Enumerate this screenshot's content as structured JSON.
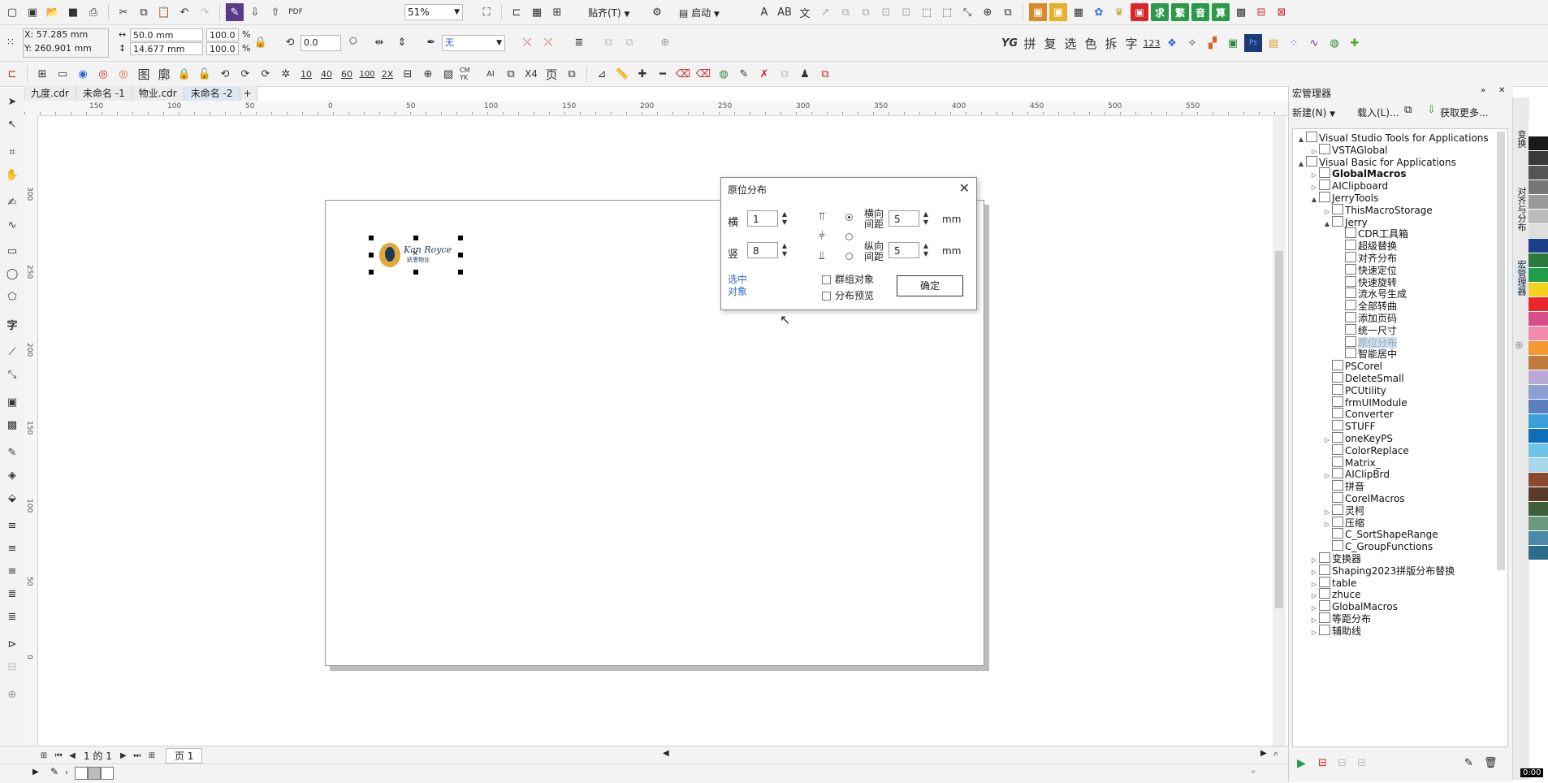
{
  "toolbar1": {
    "zoom": "51%",
    "snap_label": "贴齐(T)",
    "launch_label": "启动",
    "right_glyphs": [
      "求",
      "繁",
      "音",
      "算"
    ]
  },
  "toolbar2": {
    "x": "X: 57.285 mm",
    "y": "Y: 260.901 mm",
    "width": "50.0 mm",
    "height": "14.677 mm",
    "scale_w": "100.0",
    "scale_h": "100.0",
    "pct": "%",
    "angle": "0.0",
    "outline": "无",
    "right_glyphs": [
      "YG",
      "拼",
      "复",
      "选",
      "色",
      "拆",
      "字",
      "123"
    ]
  },
  "toolbar3": {
    "labels": [
      "图",
      "廓",
      "10",
      "40",
      "60",
      "100",
      "2X",
      "CM YK",
      "X4",
      "页"
    ]
  },
  "tabs": [
    "九度.cdr",
    "未命名 -1",
    "物业.cdr",
    "未命名 -2"
  ],
  "ruler_h": [
    "150",
    "100",
    "50",
    "0",
    "50",
    "100",
    "150",
    "200",
    "250",
    "300",
    "350",
    "400",
    "450",
    "500",
    "550"
  ],
  "ruler_v": [
    "300",
    "250",
    "200",
    "150",
    "100",
    "50",
    "0"
  ],
  "logo_text": "Kan Royce",
  "logo_subtext": "凯恩物业",
  "dialog": {
    "title": "原位分布",
    "h_label": "横",
    "h_value": "1",
    "v_label": "竖",
    "v_value": "8",
    "hspace_label": "横向间距",
    "hspace_value": "5",
    "vspace_label": "纵向间距",
    "vspace_value": "5",
    "unit": "mm",
    "select_link": "选中对象",
    "group_label": "群组对象",
    "preview_label": "分布预览",
    "ok_label": "确定"
  },
  "status": {
    "page_of": "1 的 1",
    "page_tab": "页 1"
  },
  "panel": {
    "title": "宏管理器",
    "new_label": "新建(N)",
    "load_label": "载入(L)...",
    "get_more": "获取更多...",
    "tree": [
      {
        "label": "Visual Studio Tools for Applications",
        "level": 0,
        "exp": "▲",
        "bold": false
      },
      {
        "label": "VSTAGlobal",
        "level": 1,
        "exp": "▷",
        "bold": false
      },
      {
        "label": "Visual Basic for Applications",
        "level": 0,
        "exp": "▲",
        "bold": false
      },
      {
        "label": "GlobalMacros",
        "level": 1,
        "exp": "▷",
        "bold": true
      },
      {
        "label": "AIClipboard",
        "level": 1,
        "exp": "▷",
        "bold": false
      },
      {
        "label": "JerryTools",
        "level": 1,
        "exp": "▲",
        "bold": false
      },
      {
        "label": "ThisMacroStorage",
        "level": 2,
        "exp": "▷",
        "bold": false
      },
      {
        "label": "Jerry",
        "level": 2,
        "exp": "▲",
        "bold": false
      },
      {
        "label": "CDR工具箱",
        "level": 3,
        "exp": "",
        "bold": false
      },
      {
        "label": "超级替换",
        "level": 3,
        "exp": "",
        "bold": false
      },
      {
        "label": "对齐分布",
        "level": 3,
        "exp": "",
        "bold": false
      },
      {
        "label": "快速定位",
        "level": 3,
        "exp": "",
        "bold": false
      },
      {
        "label": "快速旋转",
        "level": 3,
        "exp": "",
        "bold": false
      },
      {
        "label": "流水号生成",
        "level": 3,
        "exp": "",
        "bold": false
      },
      {
        "label": "全部转曲",
        "level": 3,
        "exp": "",
        "bold": false
      },
      {
        "label": "添加页码",
        "level": 3,
        "exp": "",
        "bold": false
      },
      {
        "label": "统一尺寸",
        "level": 3,
        "exp": "",
        "bold": false
      },
      {
        "label": "原位分布",
        "level": 3,
        "exp": "",
        "bold": false,
        "sel": true
      },
      {
        "label": "智能居中",
        "level": 3,
        "exp": "",
        "bold": false
      },
      {
        "label": "PSCorel",
        "level": 2,
        "exp": "",
        "bold": false
      },
      {
        "label": "DeleteSmall",
        "level": 2,
        "exp": "",
        "bold": false
      },
      {
        "label": "PCUtility",
        "level": 2,
        "exp": "",
        "bold": false
      },
      {
        "label": "frmUIModule",
        "level": 2,
        "exp": "",
        "bold": false
      },
      {
        "label": "Converter",
        "level": 2,
        "exp": "",
        "bold": false
      },
      {
        "label": "STUFF",
        "level": 2,
        "exp": "",
        "bold": false
      },
      {
        "label": "oneKeyPS",
        "level": 2,
        "exp": "▷",
        "bold": false
      },
      {
        "label": "ColorReplace",
        "level": 2,
        "exp": "",
        "bold": false
      },
      {
        "label": "Matrix_",
        "level": 2,
        "exp": "",
        "bold": false
      },
      {
        "label": "AIClipBrd",
        "level": 2,
        "exp": "▷",
        "bold": false
      },
      {
        "label": "拼音",
        "level": 2,
        "exp": "",
        "bold": false
      },
      {
        "label": "CorelMacros",
        "level": 2,
        "exp": "",
        "bold": false
      },
      {
        "label": "灵柯",
        "level": 2,
        "exp": "▷",
        "bold": false
      },
      {
        "label": "压缩",
        "level": 2,
        "exp": "▷",
        "bold": false
      },
      {
        "label": "C_SortShapeRange",
        "level": 2,
        "exp": "",
        "bold": false
      },
      {
        "label": "C_GroupFunctions",
        "level": 2,
        "exp": "",
        "bold": false
      },
      {
        "label": "变换器",
        "level": 1,
        "exp": "▷",
        "bold": false
      },
      {
        "label": "Shaping2023拼版分布替换",
        "level": 1,
        "exp": "▷",
        "bold": false
      },
      {
        "label": "table",
        "level": 1,
        "exp": "▷",
        "bold": false
      },
      {
        "label": "zhuce",
        "level": 1,
        "exp": "▷",
        "bold": false
      },
      {
        "label": "GlobalMacros",
        "level": 1,
        "exp": "▷",
        "bold": false
      },
      {
        "label": "等距分布",
        "level": 1,
        "exp": "▷",
        "bold": false
      },
      {
        "label": "辅助线",
        "level": 1,
        "exp": "▷",
        "bold": false
      }
    ]
  },
  "vtabs": [
    "变换",
    "对齐与分布",
    "宏管理器"
  ],
  "palette": [
    "#ffffff",
    "#1a1a1a",
    "#3a3a3a",
    "#555555",
    "#777777",
    "#999999",
    "#bbbbbb",
    "#dddddd",
    "#1b3f8b",
    "#2a7a3a",
    "#1e9e4a",
    "#f2d21b",
    "#e8262b",
    "#d84c8a",
    "#f28ab0",
    "#f49a2e",
    "#c07a3c",
    "#b8a8d8",
    "#8aa0d0",
    "#5b7fbf",
    "#3a9fd8",
    "#0d6fb8",
    "#6dc3e8",
    "#a7d8ec",
    "#8b4a2b",
    "#5a3a2a",
    "#3b5e3b",
    "#6a9a7a",
    "#4a8aa8",
    "#2d6b8a"
  ],
  "clock": "0:00"
}
